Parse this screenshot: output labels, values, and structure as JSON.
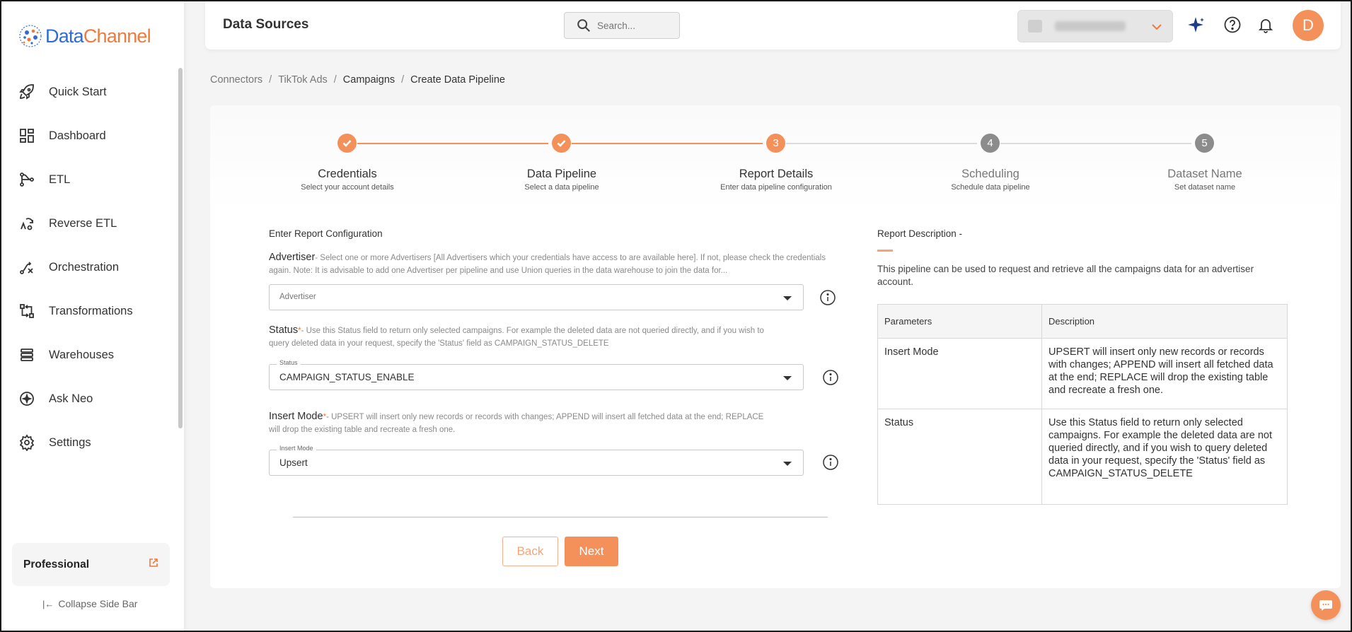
{
  "app": {
    "logo_part1": "Data",
    "logo_part2": "Channel",
    "brand_blue": "#2f6bd9",
    "brand_orange": "#ee7a3c"
  },
  "sidebar": {
    "items": [
      {
        "label": "Quick Start",
        "icon": "rocket-icon"
      },
      {
        "label": "Dashboard",
        "icon": "dashboard-icon"
      },
      {
        "label": "ETL",
        "icon": "etl-icon"
      },
      {
        "label": "Reverse ETL",
        "icon": "reverse-etl-icon"
      },
      {
        "label": "Orchestration",
        "icon": "orchestration-icon"
      },
      {
        "label": "Transformations",
        "icon": "transformations-icon"
      },
      {
        "label": "Warehouses",
        "icon": "warehouses-icon"
      },
      {
        "label": "Ask Neo",
        "icon": "ask-neo-icon"
      },
      {
        "label": "Settings",
        "icon": "gear-icon"
      }
    ],
    "plan": "Professional",
    "collapse_label": "Collapse Side Bar"
  },
  "header": {
    "title": "Data Sources",
    "search_placeholder": "Search...",
    "avatar_initial": "D"
  },
  "breadcrumb": [
    "Connectors",
    "TikTok Ads",
    "Campaigns",
    "Create Data Pipeline"
  ],
  "stepper": {
    "steps": [
      {
        "number": "1",
        "title": "Credentials",
        "subtitle": "Select your account details",
        "state": "done"
      },
      {
        "number": "2",
        "title": "Data Pipeline",
        "subtitle": "Select a data pipeline",
        "state": "done"
      },
      {
        "number": "3",
        "title": "Report Details",
        "subtitle": "Enter data pipeline configuration",
        "state": "active"
      },
      {
        "number": "4",
        "title": "Scheduling",
        "subtitle": "Schedule data pipeline",
        "state": "pending"
      },
      {
        "number": "5",
        "title": "Dataset Name",
        "subtitle": "Set dataset name",
        "state": "pending"
      }
    ]
  },
  "form": {
    "section_title": "Enter Report Configuration",
    "advertiser": {
      "label": "Advertiser",
      "description": "- Select one or more Advertisers [All Advertisers which your credentials have access to are available here]. If not, please check the credentials again. Note: It is advisable to add one Advertiser per pipeline and use Union queries in the data warehouse to join the data for...",
      "placeholder": "Advertiser"
    },
    "status": {
      "label": "Status",
      "required_mark": "*",
      "description": "- Use this Status field to return only selected campaigns. For example the deleted data are not queried directly, and if you wish to query deleted data in your request, specify the 'Status' field as CAMPAIGN_STATUS_DELETE",
      "field_label": "Status",
      "value": "CAMPAIGN_STATUS_ENABLE"
    },
    "insert_mode": {
      "label": "Insert Mode",
      "required_mark": "*",
      "description": "- UPSERT will insert only new records or records with changes; APPEND will insert all fetched data at the end; REPLACE will drop the existing table and recreate a fresh one.",
      "field_label": "Insert Mode",
      "value": "Upsert"
    },
    "back_label": "Back",
    "next_label": "Next"
  },
  "report_description": {
    "title": "Report Description -",
    "text": "This pipeline can be used to request and retrieve all the campaigns data for an advertiser account.",
    "table_headers": [
      "Parameters",
      "Description"
    ],
    "rows": [
      {
        "param": "Insert Mode",
        "desc": "UPSERT will insert only new records or records with changes; APPEND will insert all fetched data at the end; REPLACE will drop the existing table and recreate a fresh one."
      },
      {
        "param": "Status",
        "desc": "Use this Status field to return only selected campaigns. For example the deleted data are not queried directly, and if you wish to query deleted data in your request, specify the 'Status' field as CAMPAIGN_STATUS_DELETE"
      }
    ]
  },
  "colors": {
    "accent": "#f4915b",
    "pending_step": "#8c8c8c"
  }
}
